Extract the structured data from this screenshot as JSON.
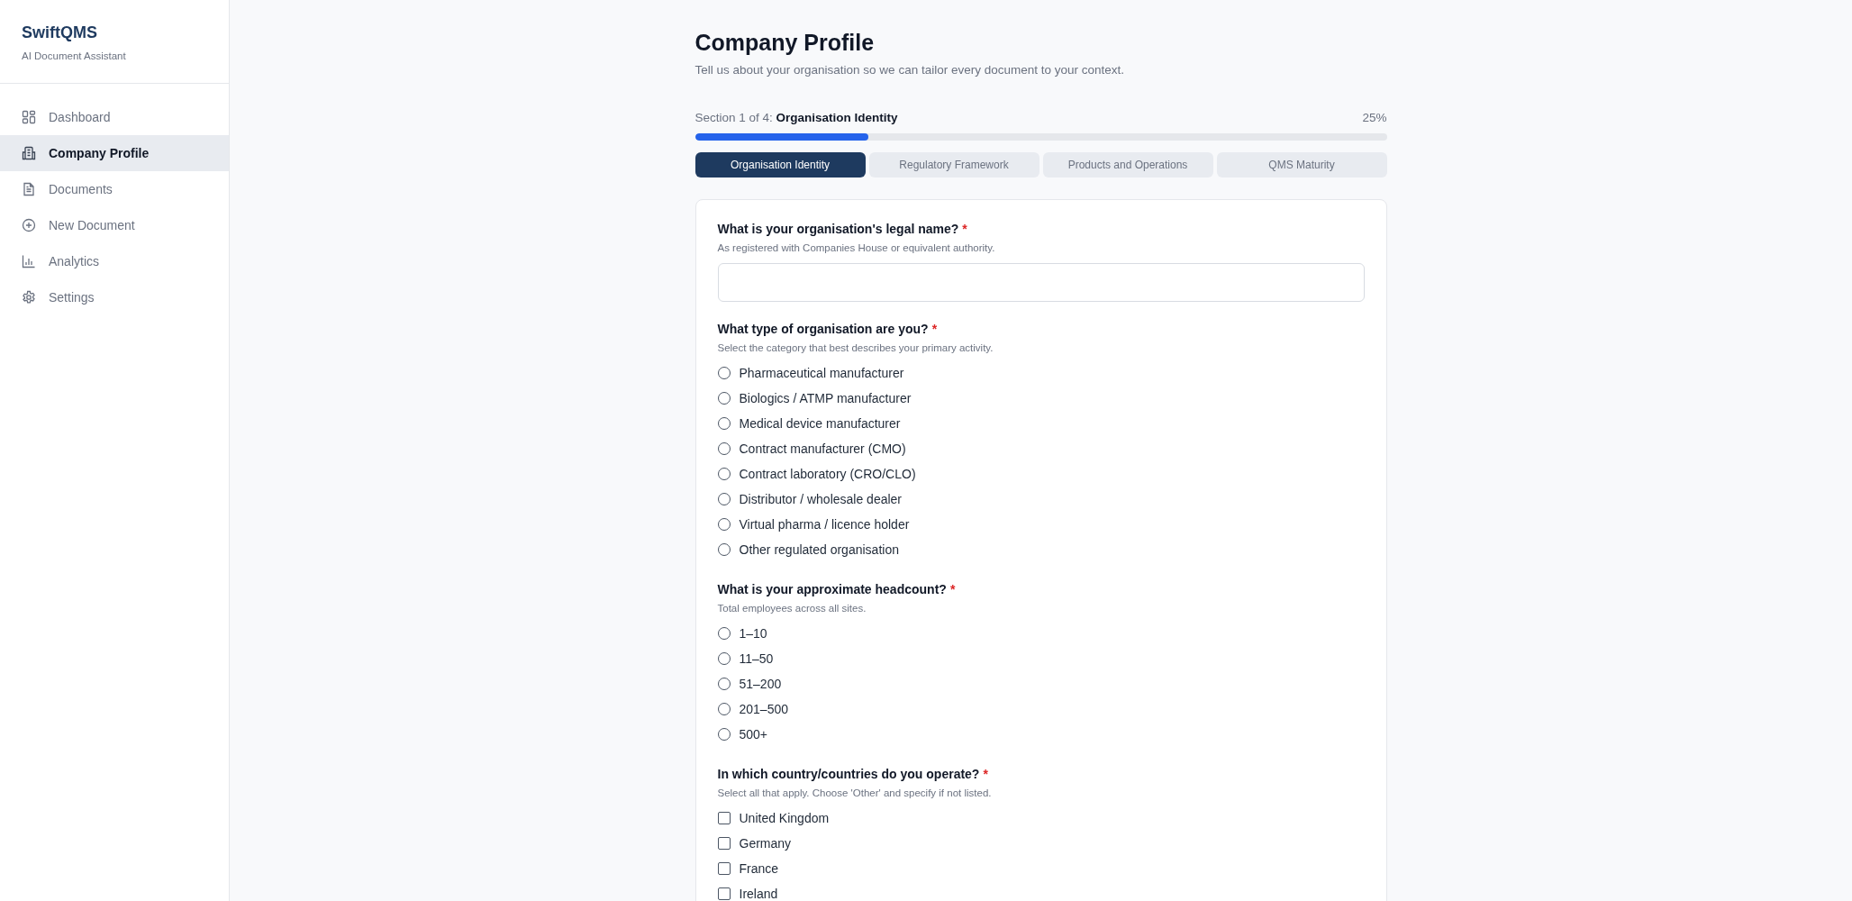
{
  "sidebar": {
    "brand": "SwiftQMS",
    "tagline": "AI Document Assistant",
    "items": [
      {
        "label": "Dashboard",
        "selected": false
      },
      {
        "label": "Company Profile",
        "selected": true
      },
      {
        "label": "Documents",
        "selected": false
      },
      {
        "label": "New Document",
        "selected": false
      },
      {
        "label": "Analytics",
        "selected": false
      },
      {
        "label": "Settings",
        "selected": false
      }
    ]
  },
  "header": {
    "title": "Company Profile",
    "subtitle": "Tell us about your organisation so we can tailor every document to your context."
  },
  "progress": {
    "label": "Section 1 of 4: **Organisation Identity**",
    "percent": "25%",
    "level": 0.25
  },
  "tabs": [
    {
      "label": "Organisation Identity",
      "selected": true
    },
    {
      "label": "Regulatory Framework",
      "selected": false
    },
    {
      "label": "Products and Operations",
      "selected": false
    },
    {
      "label": "QMS Maturity",
      "selected": false
    }
  ],
  "questions": [
    {
      "kind": "text",
      "label": "What is your organisation's legal name?",
      "required_mark": "*",
      "hint": "As registered with Companies House or equivalent authority."
    },
    {
      "kind": "radio",
      "label": "What type of organisation are you?",
      "required_mark": "*",
      "hint": "Select the category that best describes your primary activity.",
      "options": [
        {
          "label": "Pharmaceutical manufacturer",
          "selected": false
        },
        {
          "label": "Biologics / ATMP manufacturer",
          "selected": false
        },
        {
          "label": "Medical device manufacturer",
          "selected": false
        },
        {
          "label": "Contract manufacturer (CMO)",
          "selected": false
        },
        {
          "label": "Contract laboratory (CRO/CLO)",
          "selected": false
        },
        {
          "label": "Distributor / wholesale dealer",
          "selected": false
        },
        {
          "label": "Virtual pharma / licence holder",
          "selected": false
        },
        {
          "label": "Other regulated organisation",
          "selected": false
        }
      ]
    },
    {
      "kind": "radio",
      "label": "What is your approximate headcount?",
      "required_mark": "*",
      "hint": "Total employees across all sites.",
      "options": [
        {
          "label": "1–10",
          "selected": false
        },
        {
          "label": "11–50",
          "selected": false
        },
        {
          "label": "51–200",
          "selected": false
        },
        {
          "label": "201–500",
          "selected": false
        },
        {
          "label": "500+",
          "selected": false
        }
      ]
    },
    {
      "kind": "checkbox",
      "label": "In which country/countries do you operate?",
      "required_mark": "*",
      "hint": "Select all that apply. Choose 'Other' and specify if not listed.",
      "options": [
        {
          "label": "United Kingdom",
          "checked": false
        },
        {
          "label": "Germany",
          "checked": false
        },
        {
          "label": "France",
          "checked": false
        },
        {
          "label": "Ireland",
          "checked": false
        }
      ]
    }
  ]
}
